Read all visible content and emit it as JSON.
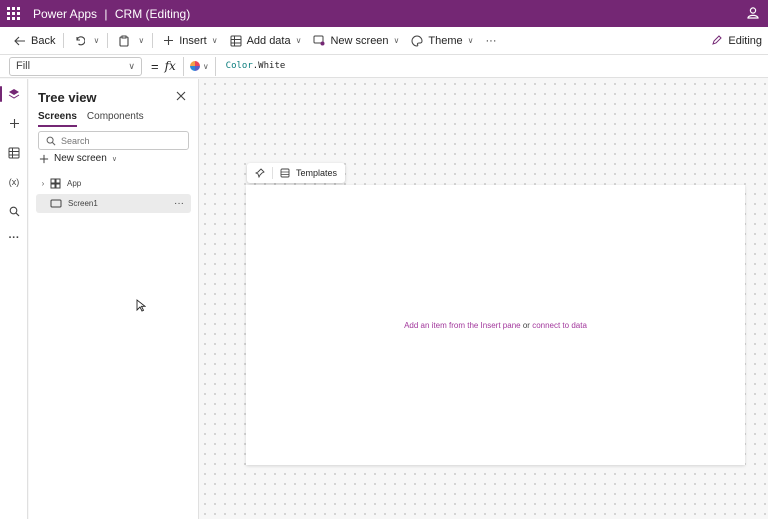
{
  "app": {
    "product": "Power Apps",
    "separator": "|",
    "title": "CRM (Editing)"
  },
  "toolbar": {
    "back_label": "Back",
    "insert_label": "Insert",
    "add_data_label": "Add data",
    "new_screen_label": "New screen",
    "theme_label": "Theme",
    "more_label": "···",
    "editing_label": "Editing"
  },
  "formula_bar": {
    "property": "Fill",
    "equals": "=",
    "fx": "fx",
    "formula_object": "Color",
    "formula_member": ".White"
  },
  "tree_view": {
    "title": "Tree view",
    "tabs": [
      "Screens",
      "Components"
    ],
    "search_placeholder": "Search",
    "new_screen_label": "New screen",
    "nodes": [
      {
        "label": "App",
        "icon": "app-icon"
      },
      {
        "label": "Screen1",
        "icon": "screen-icon",
        "selected": true
      }
    ]
  },
  "canvas": {
    "templates_label": "Templates",
    "hint_link1": "Add an item from the Insert pane",
    "hint_or": "or",
    "hint_link2": "connect to data"
  },
  "colors": {
    "brand": "#742774",
    "link": "#a2379c"
  },
  "rail_icons": [
    "layers-icon",
    "plus-icon",
    "data-icon",
    "variables-icon",
    "search-icon",
    "more-icon"
  ]
}
